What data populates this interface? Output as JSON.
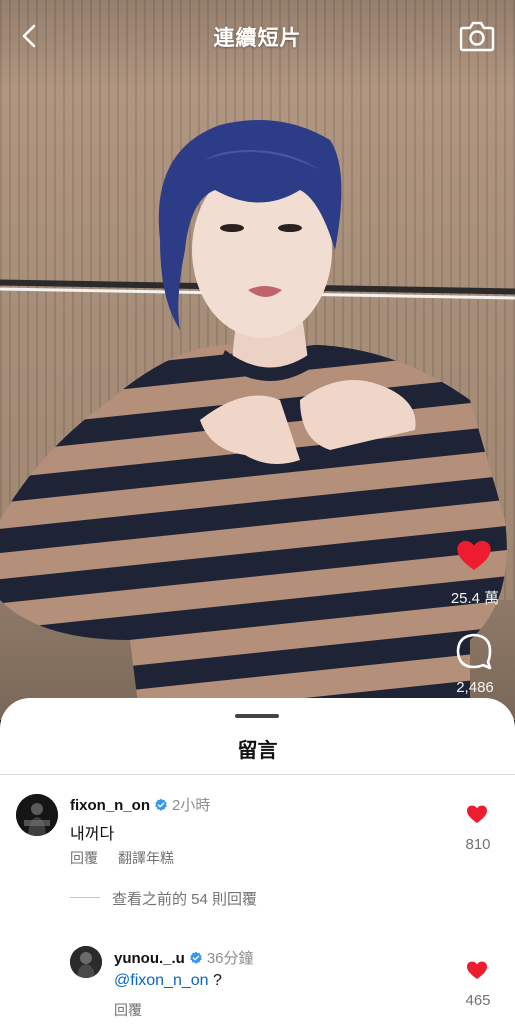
{
  "header": {
    "title": "連續短片"
  },
  "reel": {
    "likes": "25.4 萬",
    "comments": "2,486"
  },
  "comments_sheet": {
    "title": "留言",
    "comments": [
      {
        "username": "fixon_n_on",
        "time": "2小時",
        "text": "내꺼다",
        "reply_label": "回覆",
        "translate_label": "翻譯年糕",
        "like_count": "810"
      }
    ],
    "view_replies": "查看之前的 54 則回覆",
    "reply": {
      "username": "yunou._.u",
      "time": "36分鐘",
      "mention": "@fixon_n_on",
      "text_suffix": "?",
      "reply_label": "回覆",
      "like_count": "465"
    }
  },
  "colors": {
    "like_red": "#ed1c2e",
    "verified_blue": "#3897f0",
    "mention_blue": "#0a66c2"
  },
  "icons": [
    "back-arrow-icon",
    "camera-icon",
    "heart-icon",
    "comment-bubble-icon",
    "verified-badge-icon"
  ]
}
